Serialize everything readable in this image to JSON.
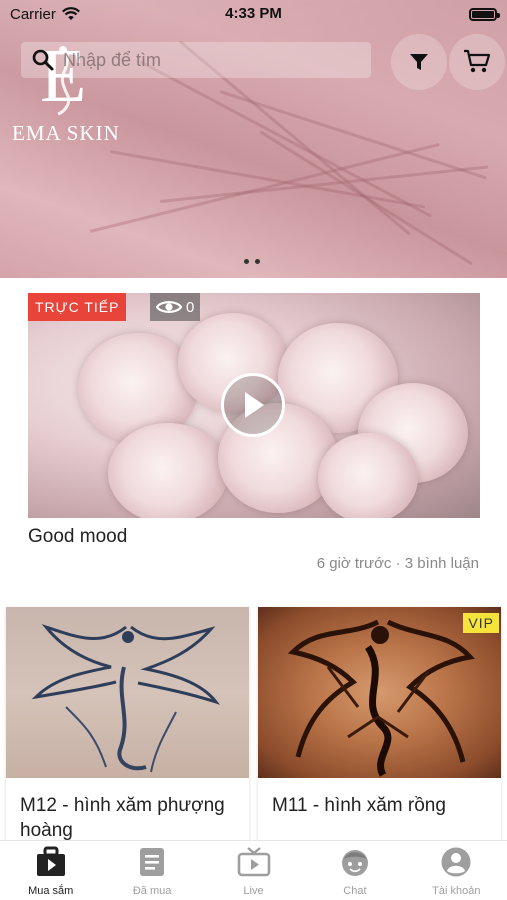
{
  "status_bar": {
    "carrier": "Carrier",
    "time": "4:33 PM"
  },
  "header": {
    "brand_letter": "E",
    "brand_name": "EMA SKIN",
    "search_placeholder": "Nhập để tìm",
    "icons": [
      "search-icon",
      "filter-icon",
      "cart-icon"
    ]
  },
  "banner": {
    "page_count": 2,
    "active_index": 0
  },
  "live": {
    "badge": "TRỰC TIẾP",
    "viewers": "0",
    "title": "Good mood",
    "meta": "6 giờ trước · 3 bình luận"
  },
  "products": [
    {
      "title": "M12 - hình xăm phượng hoàng",
      "badge": ""
    },
    {
      "title": "M11 - hình xăm rồng",
      "badge": "VIP"
    }
  ],
  "tabs": [
    {
      "label": "Mua sắm",
      "icon": "shopping-play-icon",
      "active": true
    },
    {
      "label": "Đã mua",
      "icon": "document-icon",
      "active": false
    },
    {
      "label": "Live",
      "icon": "tv-icon",
      "active": false
    },
    {
      "label": "Chat",
      "icon": "chat-face-icon",
      "active": false
    },
    {
      "label": "Tài khoản",
      "icon": "account-icon",
      "active": false
    }
  ],
  "colors": {
    "live_red": "#e8443a",
    "vip_yellow": "#f6e43a",
    "banner_pink": "#d4a3a9"
  }
}
